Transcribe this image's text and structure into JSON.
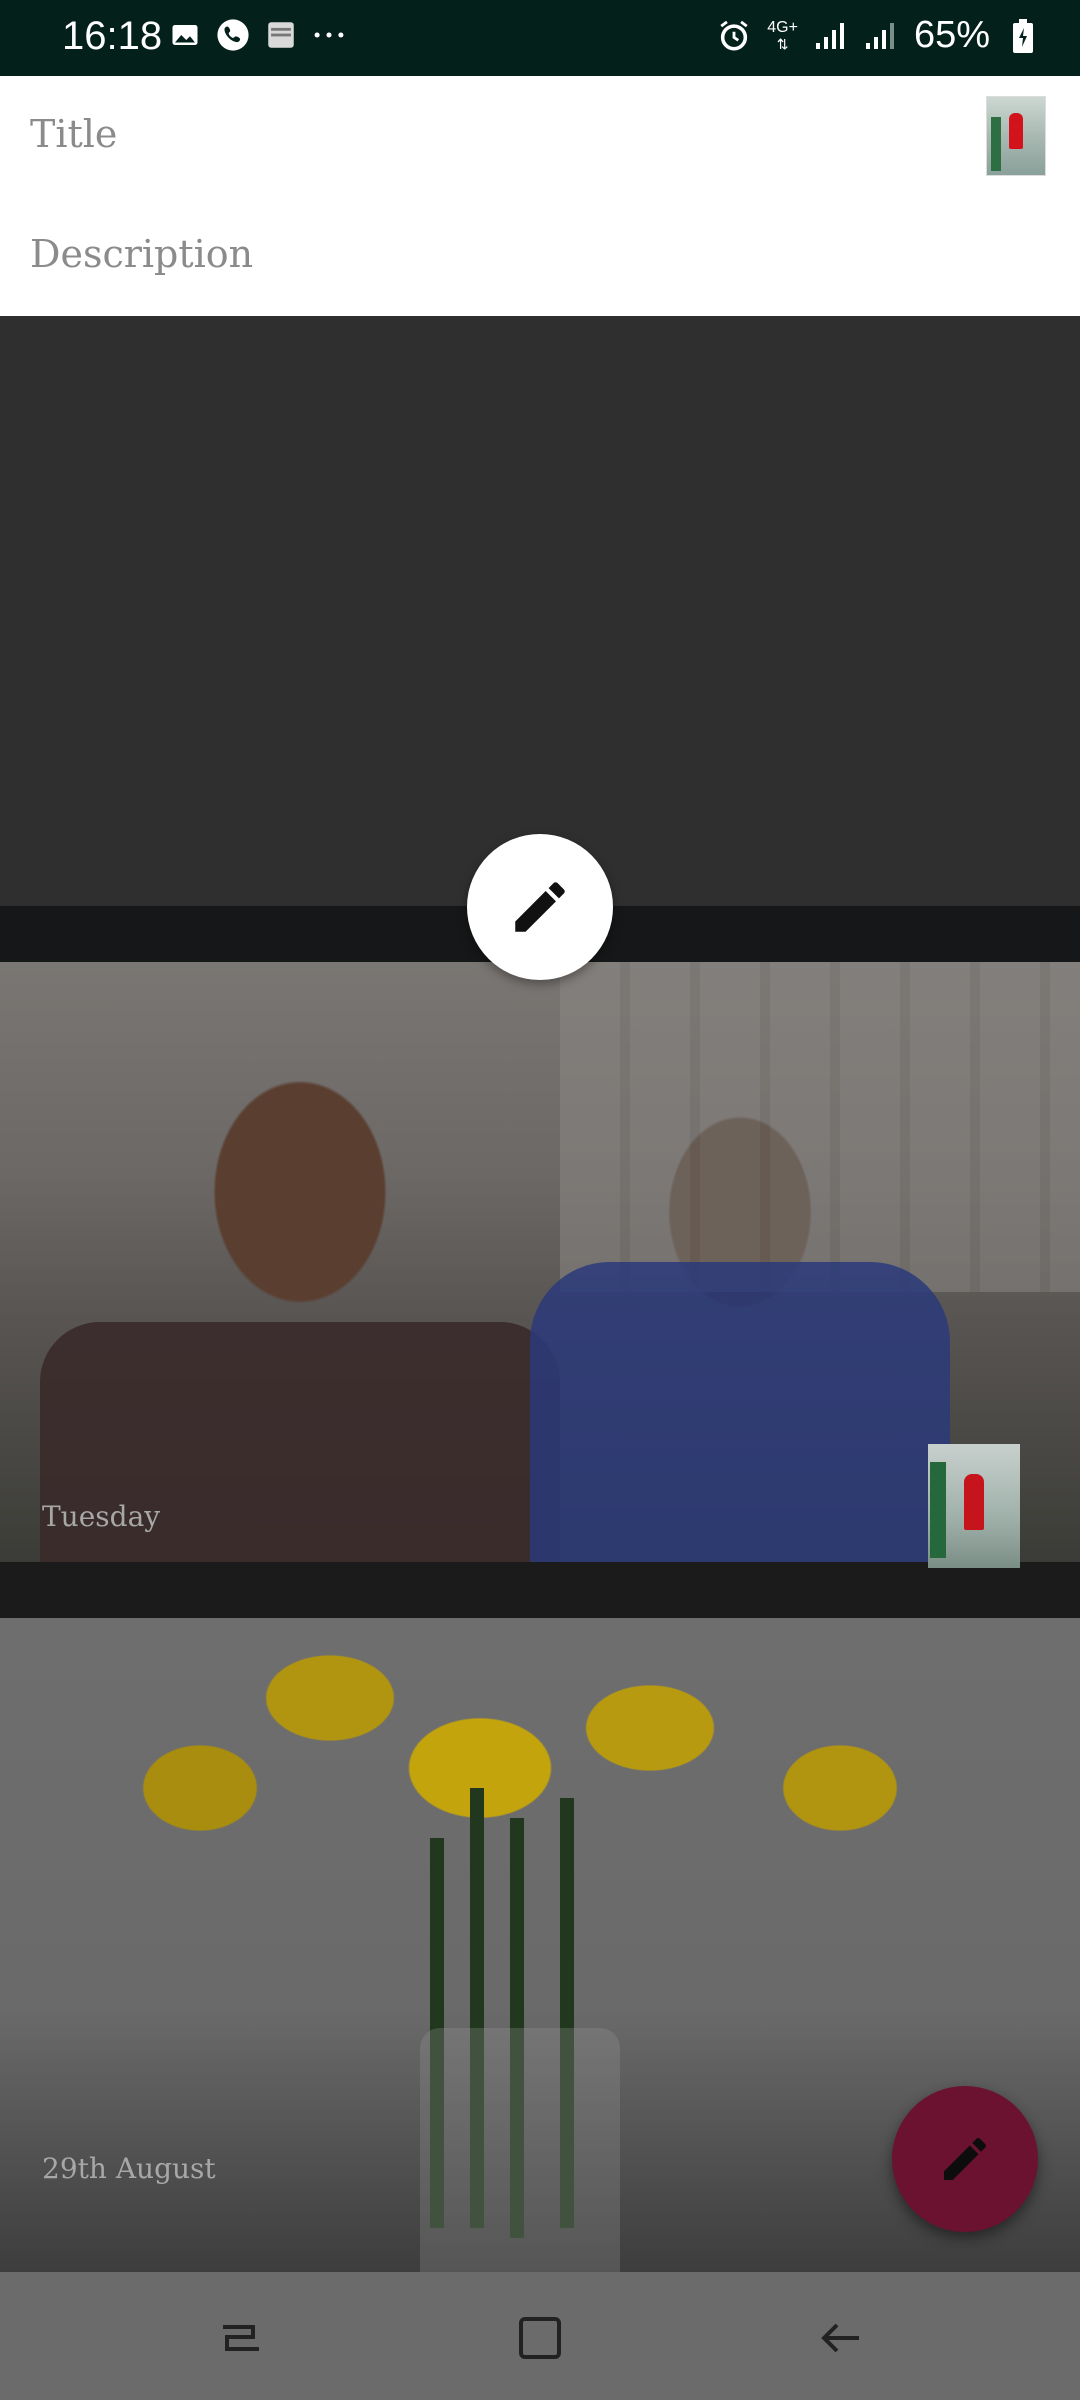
{
  "status_bar": {
    "time": "16:18",
    "left_icons": [
      "gallery-icon",
      "phone-icon",
      "bible-app-icon",
      "more-icon"
    ],
    "network_label": "4G+",
    "battery_percent": "65%"
  },
  "editor": {
    "title_placeholder": "Title",
    "description_placeholder": "Description"
  },
  "entries": [
    {
      "date": "Tuesday"
    },
    {
      "date": "29th August"
    }
  ],
  "colors": {
    "status_bar_bg": "#04201a",
    "fab_accent": "#6a1230",
    "overlay_dim": "#2f2f2f"
  },
  "nav": {
    "buttons": [
      "recents-icon",
      "home-icon",
      "back-icon"
    ]
  }
}
